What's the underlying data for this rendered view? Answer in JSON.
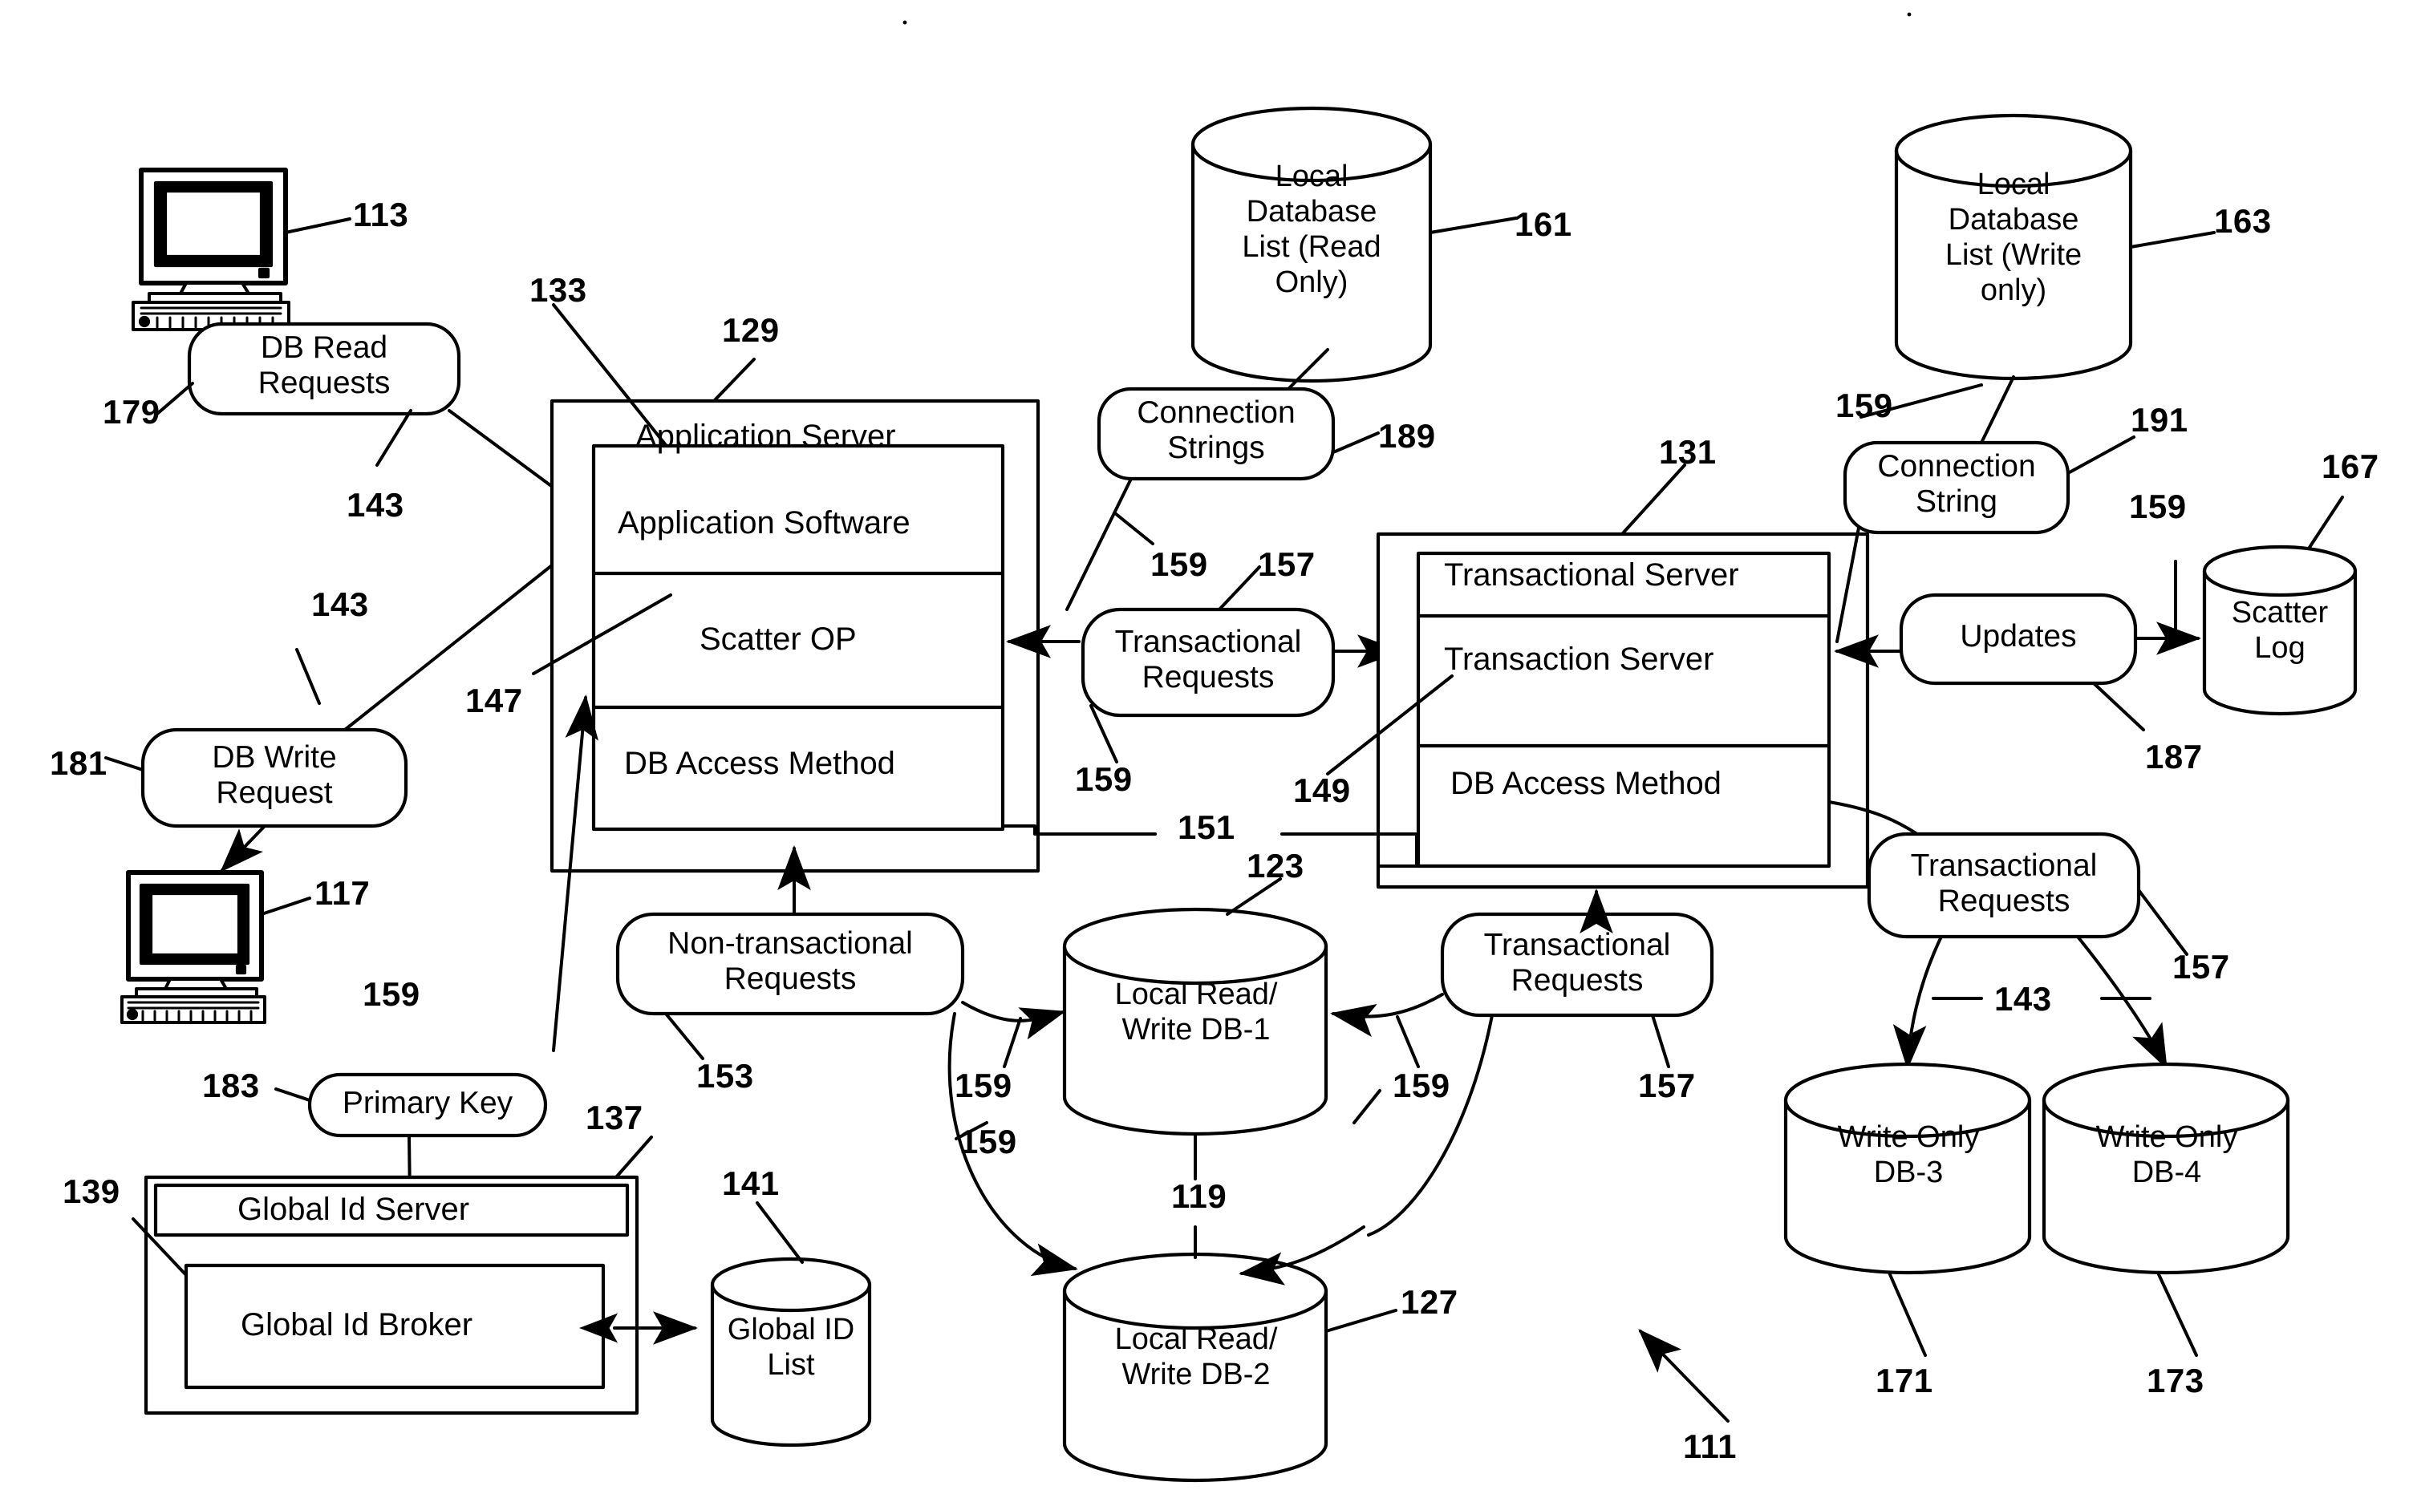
{
  "figure": {
    "title": "Distributed Database System Architecture Diagram",
    "overall_ref": "111"
  },
  "terminals": [
    {
      "name": "read-terminal",
      "ref": "113"
    },
    {
      "name": "write-terminal",
      "ref": "117"
    }
  ],
  "request_bubbles": [
    {
      "id": "db_read_requests",
      "label": "DB Read\nRequests",
      "ref": "179"
    },
    {
      "id": "db_write_request",
      "label": "DB Write\nRequest",
      "ref": "181"
    },
    {
      "id": "primary_key",
      "label": "Primary Key",
      "ref": "183"
    },
    {
      "id": "connection_strings",
      "label": "Connection\nStrings",
      "ref": "189"
    },
    {
      "id": "transactional_requests_mid",
      "label": "Transactional\nRequests",
      "ref": "157"
    },
    {
      "id": "connection_string_right",
      "label": "Connection\nString",
      "ref": "191"
    },
    {
      "id": "updates",
      "label": "Updates",
      "ref": "187"
    },
    {
      "id": "non_transactional_requests",
      "label": "Non-transactional\nRequests",
      "ref": "153"
    },
    {
      "id": "transactional_requests_lower",
      "label": "Transactional\nRequests",
      "ref": "157"
    },
    {
      "id": "transactional_requests_right",
      "label": "Transactional\nRequests",
      "ref": "157"
    }
  ],
  "application_server": {
    "title": "Application Server",
    "ref": "129",
    "ref_software": "133",
    "rows": [
      {
        "label": "Application Software"
      },
      {
        "label": "Scatter OP"
      },
      {
        "label": "DB Access Method"
      }
    ]
  },
  "transactional_server": {
    "title": "Transactional Server",
    "ref": "131",
    "ref_inner": "149",
    "rows": [
      {
        "label": "Transaction Server"
      },
      {
        "label": "DB Access Method"
      }
    ]
  },
  "global_id_server": {
    "title": "Global Id Server",
    "ref": "137",
    "ref_outer": "139",
    "inner_label": "Global Id Broker"
  },
  "cylinders": [
    {
      "id": "local_db_list_read",
      "label": "Local\nDatabase\nList (Read\nOnly)",
      "ref": "161"
    },
    {
      "id": "local_db_list_write",
      "label": "Local\nDatabase\nList (Write\nonly)",
      "ref": "163"
    },
    {
      "id": "scatter_log",
      "label": "Scatter\nLog",
      "ref": "167"
    },
    {
      "id": "global_id_list",
      "label": "Global ID\nList",
      "ref": "141"
    },
    {
      "id": "local_rw_db1",
      "label": "Local Read/\nWrite DB-1",
      "ref": "123"
    },
    {
      "id": "local_rw_db2",
      "label": "Local Read/\nWrite DB-2",
      "ref": "127"
    },
    {
      "id": "write_only_db3",
      "label": "Write Only\nDB-3",
      "ref": "171"
    },
    {
      "id": "write_only_db4",
      "label": "Write Only\nDB-4",
      "ref": "173"
    }
  ],
  "reference_numbers": {
    "r113": "113",
    "r117": "117",
    "r119": "119",
    "r123": "123",
    "r127": "127",
    "r129": "129",
    "r131": "131",
    "r133": "133",
    "r137": "137",
    "r139": "139",
    "r141": "141",
    "r143_a": "143",
    "r143_b": "143",
    "r143_c": "143",
    "r147": "147",
    "r149": "149",
    "r151": "151",
    "r153": "153",
    "r157_a": "157",
    "r157_b": "157",
    "r157_c": "157",
    "r159_a": "159",
    "r159_b": "159",
    "r159_c": "159",
    "r159_d": "159",
    "r159_e": "159",
    "r159_f": "159",
    "r159_g": "159",
    "r159_h": "159",
    "r161": "161",
    "r163": "163",
    "r167": "167",
    "r171": "171",
    "r173": "173",
    "r179": "179",
    "r181": "181",
    "r183": "183",
    "r187": "187",
    "r189": "189",
    "r191": "191",
    "r111": "111"
  },
  "colors": {
    "ink": "#000000",
    "paper": "#ffffff"
  }
}
